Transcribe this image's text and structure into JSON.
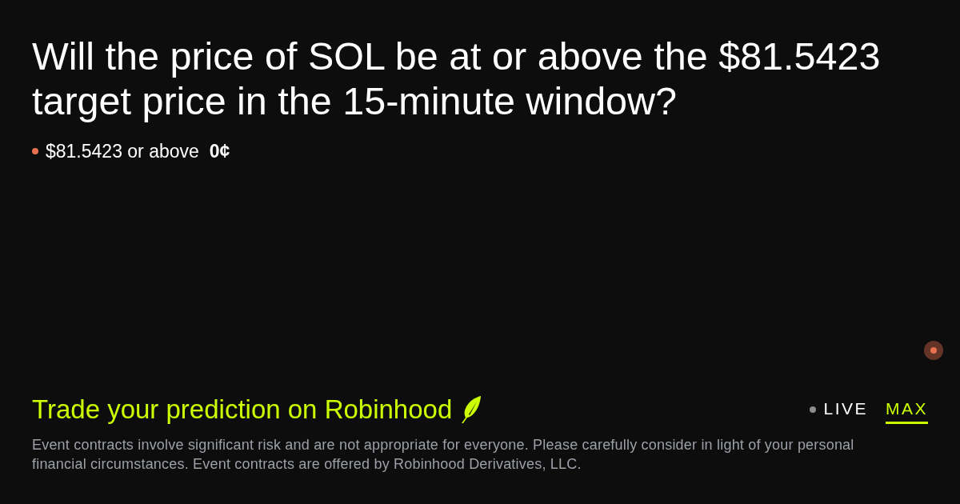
{
  "title": "Will the price of SOL be at or above the $81.5423 target price in the 15-minute window?",
  "legend": [
    {
      "label": "$81.5423 or above",
      "value": "0¢",
      "color": "#e8704f"
    }
  ],
  "cta": {
    "text": "Trade your prediction on Robinhood"
  },
  "range_tabs": [
    {
      "label": "LIVE",
      "kind": "live",
      "selected": false
    },
    {
      "label": "MAX",
      "kind": "range",
      "selected": true
    }
  ],
  "disclaimer": "Event contracts involve significant risk and are not appropriate for everyone. Please carefully consider in light of your personal financial circumstances. Event contracts are offered by Robinhood Derivatives, LLC."
}
